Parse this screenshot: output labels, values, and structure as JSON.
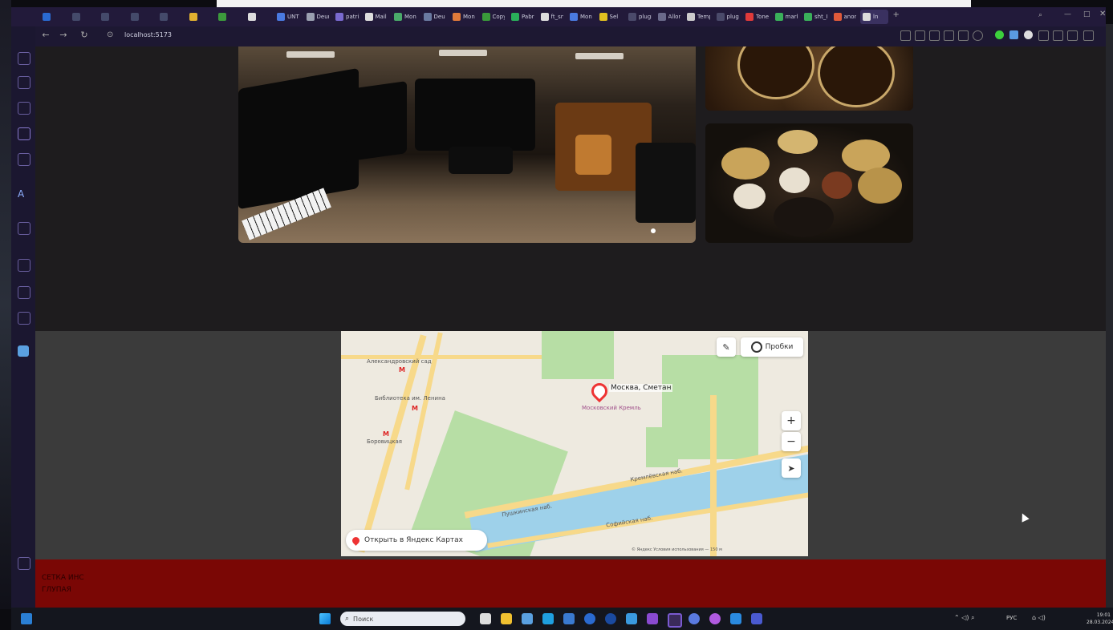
{
  "browser": {
    "url": "localhost:5173",
    "tabs": [
      {
        "label": "",
        "color": "#2a6ad0"
      },
      {
        "label": "",
        "color": "#444a6a"
      },
      {
        "label": "",
        "color": "#444a6a"
      },
      {
        "label": "",
        "color": "#444a6a"
      },
      {
        "label": "",
        "color": "#444a6a"
      },
      {
        "label": "",
        "color": "#e0b030"
      },
      {
        "label": "",
        "color": "#3c9a3c"
      },
      {
        "label": "",
        "color": "#dddddd"
      },
      {
        "label": "UNT",
        "color": "#4a7ae0"
      },
      {
        "label": "Deun",
        "color": "#9aa0b0"
      },
      {
        "label": "patri",
        "color": "#7a6ad0"
      },
      {
        "label": "Mail",
        "color": "#dddddd"
      },
      {
        "label": "Mon",
        "color": "#4aaa6a"
      },
      {
        "label": "Deu",
        "color": "#6a7aa0"
      },
      {
        "label": "Mon",
        "color": "#e07a3a"
      },
      {
        "label": "Copy",
        "color": "#3a9a3a"
      },
      {
        "label": "Pabr",
        "color": "#2ab05a"
      },
      {
        "label": "ft_sn",
        "color": "#dddddd"
      },
      {
        "label": "Mon",
        "color": "#4a7ae0"
      },
      {
        "label": "Sel",
        "color": "#e0c020"
      },
      {
        "label": "plugi",
        "color": "#4a4a6a"
      },
      {
        "label": "Allor",
        "color": "#6a6a8a"
      },
      {
        "label": "Temp",
        "color": "#cccccc"
      },
      {
        "label": "plugi",
        "color": "#4a4a6a"
      },
      {
        "label": "Toner",
        "color": "#e03a3a"
      },
      {
        "label": "mark",
        "color": "#3ab05a"
      },
      {
        "label": "sht_I",
        "color": "#3ab05a"
      },
      {
        "label": "anon",
        "color": "#e05a3a"
      },
      {
        "label": "ln",
        "color": "#dddddd",
        "active": true
      }
    ]
  },
  "map": {
    "pin_label": "Москва, Сметан",
    "traffic_label": "Пробки",
    "open_label": "Открыть в Яндекс Картах",
    "zoom_in": "+",
    "zoom_out": "−",
    "copyright": "© Яндекс  Условия использования  — 150 м",
    "labels": [
      {
        "text": "Александровский сад"
      },
      {
        "text": "Библиотека им. Ленина"
      },
      {
        "text": "Боровицкая"
      },
      {
        "text": "Московский Кремль"
      },
      {
        "text": "Пушкинская наб."
      },
      {
        "text": "Кремлёвская наб."
      },
      {
        "text": "Софийская наб."
      }
    ]
  },
  "footer": {
    "line1": "СЕТКА ИНС",
    "line2": "ГЛУПАЯ"
  },
  "taskbar": {
    "search_placeholder": "Поиск",
    "lang": "РУС",
    "time": "19:01",
    "date": "28.03.2024"
  },
  "colors": {
    "page_bg": "#1e1c1e",
    "map_section_bg": "#3b3b3b",
    "footer_bg": "#7a0705",
    "browser_chrome": "#221a3a"
  }
}
